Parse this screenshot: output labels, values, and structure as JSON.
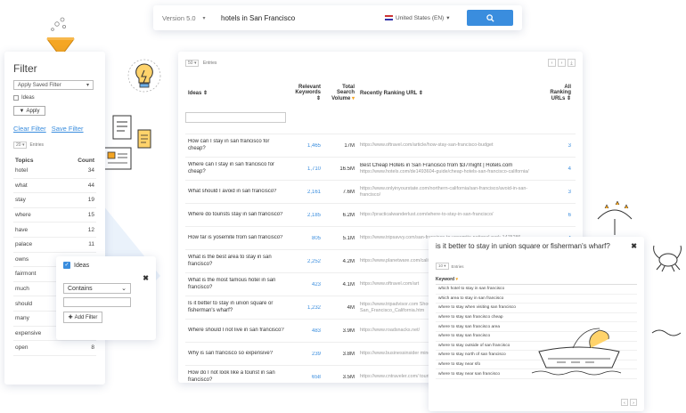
{
  "search": {
    "version": "Version 5.0",
    "query": "hotels in San Francisco",
    "region": "United States (EN)"
  },
  "filter": {
    "title": "Filter",
    "saved_filter": "Apply Saved Filter",
    "ideas_checkbox": "Ideas",
    "apply": "Apply",
    "clear": "Clear Filter",
    "save": "Save Filter",
    "entries_count": "20",
    "entries_label": "Entries",
    "col_topics": "Topics",
    "col_count": "Count",
    "topics": [
      {
        "topic": "hotel",
        "count": "34"
      },
      {
        "topic": "what",
        "count": "44"
      },
      {
        "topic": "stay",
        "count": "19"
      },
      {
        "topic": "where",
        "count": "15"
      },
      {
        "topic": "have",
        "count": "12"
      },
      {
        "topic": "palace",
        "count": "11"
      },
      {
        "topic": "owns",
        "count": "11"
      },
      {
        "topic": "fairmont",
        "count": "10"
      },
      {
        "topic": "much",
        "count": "10"
      },
      {
        "topic": "should",
        "count": "9"
      },
      {
        "topic": "many",
        "count": "9"
      },
      {
        "topic": "expensive",
        "count": "8"
      },
      {
        "topic": "open",
        "count": "8"
      }
    ]
  },
  "ideas_popup": {
    "label": "Ideas",
    "operator": "Contains",
    "add_filter": "Add Filter"
  },
  "table": {
    "entries_count": "50",
    "entries_label": "Entries",
    "headers": {
      "ideas": "Ideas",
      "relevant": "Relevant Keywords",
      "volume": "Total Search Volume",
      "url": "Recently Ranking URL",
      "all": "All Ranking URLs"
    },
    "rows": [
      {
        "idea": "How can I stay in san francisco for cheap?",
        "kw": "1,465",
        "vol": "17M",
        "url_title": "",
        "url": "https://www.oftravel.com/article/how-stay-san-francisco-budget",
        "all": "3"
      },
      {
        "idea": "Where can I stay in san francisco for cheap?",
        "kw": "1,710",
        "vol": "16.5M",
        "url_title": "Best Cheap Hotels in San Francisco from $37/night | Hotels.com",
        "url": "https://www.hotels.com/de1493604-guide/cheap-hotels-san-francisco-california/",
        "all": "4"
      },
      {
        "idea": "What should I avoid in san francisco?",
        "kw": "2,161",
        "vol": "7.6M",
        "url_title": "",
        "url": "https://www.onlyinyourstate.com/northern-california/san-francisco/avoid-in-san-francisco/",
        "all": "3"
      },
      {
        "idea": "Where do tourists stay in san francisco?",
        "kw": "2,185",
        "vol": "6.2M",
        "url_title": "",
        "url": "https://practicalwanderlust.com/where-to-stay-in-san-francisco/",
        "all": "6"
      },
      {
        "idea": "How far is yosemite from san francisco?",
        "kw": "805",
        "vol": "5.1M",
        "url_title": "",
        "url": "https://www.tripsavvy.com/san-francisco-to-yosemite-national-park-1475286",
        "all": "4"
      },
      {
        "idea": "What is the best area to stay in san francisco?",
        "kw": "2,252",
        "vol": "4.2M",
        "url_title": "",
        "url": "https://www.planetware.com/california/best-areas-hotels-us-ca-205.htm",
        "all": "4"
      },
      {
        "idea": "What is the most famous hotel in san francisco?",
        "kw": "423",
        "vol": "4.1M",
        "url_title": "",
        "url": "https://www.oftravel.com/art",
        "all": "4"
      },
      {
        "idea": "Is it better to stay in union square or fisherman's wharf?",
        "kw": "1,232",
        "vol": "4M",
        "url_title": "",
        "url": "https://www.tripadvisor.com Should_I_Stay_in_Union_Squ San_Francisco_California.htm",
        "all": "4"
      },
      {
        "idea": "Where should I not live in san francisco?",
        "kw": "483",
        "vol": "3.9M",
        "url_title": "",
        "url": "https://www.roadsnacks.net/",
        "all": "4"
      },
      {
        "idea": "Why is san francisco so expensive?",
        "kw": "239",
        "vol": "3.8M",
        "url_title": "",
        "url": "https://www.businessinsider mind-blowing-facts-2019-5",
        "all": "4"
      },
      {
        "idea": "How do I not look like a tourist in san francisco?",
        "kw": "658",
        "vol": "3.5M",
        "url_title": "",
        "url": "https://www.cntraveler.com/ tourist-in-san-francisco",
        "all": "4"
      }
    ]
  },
  "question_popup": {
    "title": "is it better to stay in union square or fisherman's wharf?",
    "entries_count": "10",
    "entries_label": "Entries",
    "col_keyword": "Keyword",
    "keywords": [
      "which hotel to stay in san francisco",
      "which area to stay in san francisco",
      "where to stay when visiting san francisco",
      "where to stay san francisco cheap",
      "where to stay san francisco area",
      "where to stay san francisco",
      "where to stay outside of san francisco",
      "where to stay north of san francisco",
      "where to stay near sfo",
      "where to stay near san francisco"
    ]
  },
  "colors": {
    "accent": "#3a8dde",
    "funnel": "#f5a623"
  },
  "icons": [
    "funnel-icon",
    "lightbulb-icon",
    "document-icon",
    "list-card-icon",
    "sailboat-illustration",
    "seagull-icon",
    "search-icon",
    "crab-illustration"
  ]
}
